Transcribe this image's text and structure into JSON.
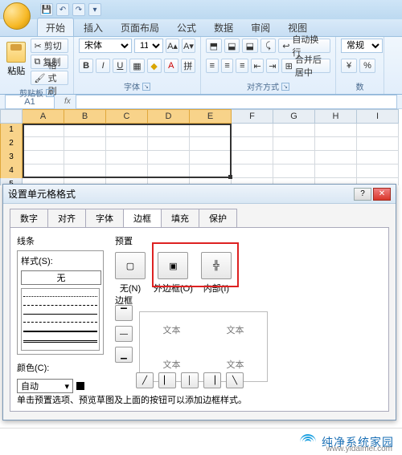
{
  "qat": {
    "save": "💾",
    "undo": "↶",
    "redo": "↷",
    "more": "▾"
  },
  "tabs": [
    "开始",
    "插入",
    "页面布局",
    "公式",
    "数据",
    "审阅",
    "视图"
  ],
  "clipboard": {
    "paste": "粘贴",
    "cut": "剪切",
    "copy": "复制",
    "format_painter": "格式刷",
    "group": "剪贴板"
  },
  "font": {
    "name": "宋体",
    "size": "11",
    "group": "字体",
    "bold": "B",
    "italic": "I",
    "underline": "U"
  },
  "align": {
    "wrap": "自动换行",
    "merge": "合并后居中",
    "group": "对齐方式"
  },
  "number": {
    "style": "常规",
    "group": "数"
  },
  "namebox": "A1",
  "columns": [
    "A",
    "B",
    "C",
    "D",
    "E",
    "F",
    "G",
    "H",
    "I"
  ],
  "rows": [
    "1",
    "2",
    "3",
    "4",
    "5"
  ],
  "dialog": {
    "title": "设置单元格格式",
    "help": "?",
    "close": "✕",
    "tabs": [
      "数字",
      "对齐",
      "字体",
      "边框",
      "填充",
      "保护"
    ],
    "line_section": "线条",
    "style_label": "样式(S):",
    "style_none": "无",
    "color_label": "颜色(C):",
    "color_auto": "自动",
    "preset_label": "预置",
    "preset_none": "无(N)",
    "preset_outline": "外边框(O)",
    "preset_inside": "内部(I)",
    "border_label": "边框",
    "sample_text": "文本",
    "hint": "单击预置选项、预览草图及上面的按钮可以添加边框样式。"
  },
  "footer": {
    "brand": "纯净系统家园",
    "url": "www.yidaimei.com"
  }
}
